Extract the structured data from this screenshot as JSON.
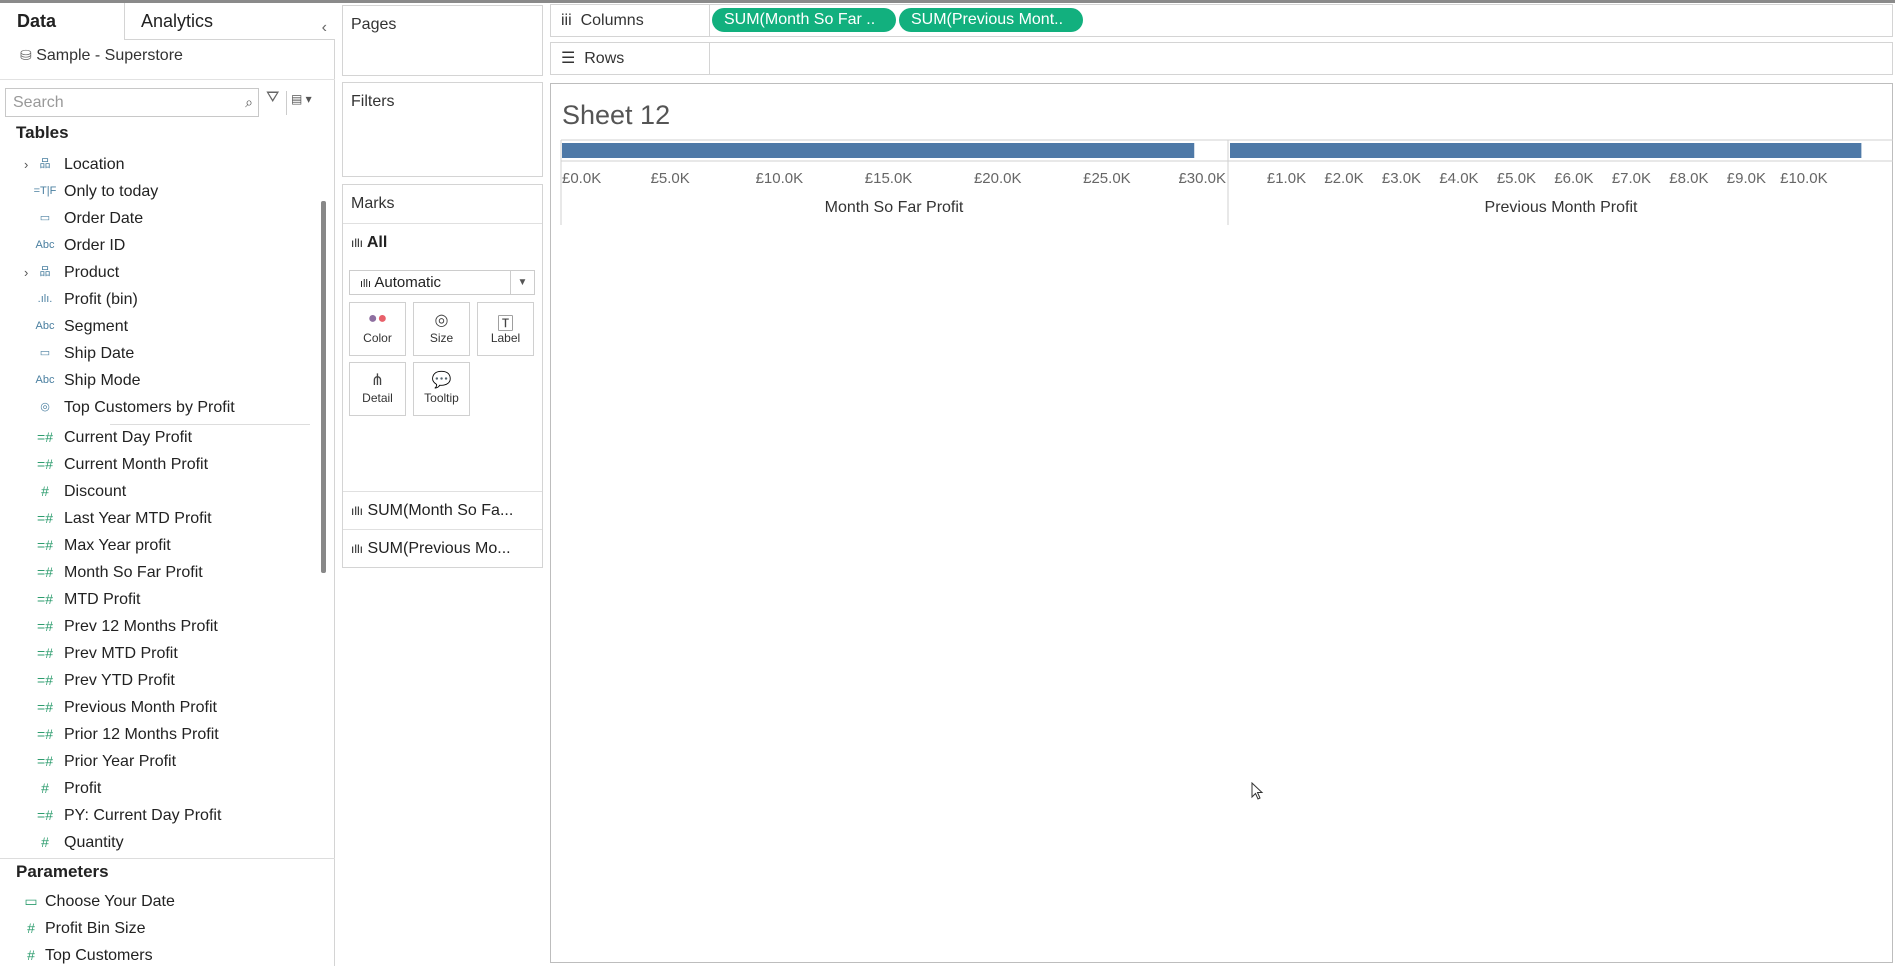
{
  "left_panel": {
    "tabs": [
      "Data",
      "Analytics"
    ],
    "data_source": "Sample - Superstore",
    "search_placeholder": "Search",
    "tables_heading": "Tables",
    "dimensions": [
      {
        "label": "Location",
        "icon": "hierarchy-icon",
        "expandable": true
      },
      {
        "label": "Only to today",
        "icon": "boolean-icon"
      },
      {
        "label": "Order Date",
        "icon": "calendar-icon"
      },
      {
        "label": "Order ID",
        "icon": "abc-icon"
      },
      {
        "label": "Product",
        "icon": "hierarchy-icon",
        "expandable": true
      },
      {
        "label": "Profit (bin)",
        "icon": "bin-icon"
      },
      {
        "label": "Segment",
        "icon": "abc-icon"
      },
      {
        "label": "Ship Date",
        "icon": "calendar-icon"
      },
      {
        "label": "Ship Mode",
        "icon": "abc-icon"
      },
      {
        "label": "Top Customers by Profit",
        "icon": "set-icon"
      }
    ],
    "measures": [
      {
        "label": "Current Day Profit",
        "icon": "calc-measure-icon"
      },
      {
        "label": "Current Month Profit",
        "icon": "calc-measure-icon"
      },
      {
        "label": "Discount",
        "icon": "measure-icon"
      },
      {
        "label": "Last Year MTD Profit",
        "icon": "calc-measure-icon"
      },
      {
        "label": "Max Year profit",
        "icon": "calc-measure-icon"
      },
      {
        "label": "Month So Far Profit",
        "icon": "calc-measure-icon"
      },
      {
        "label": "MTD Profit",
        "icon": "calc-measure-icon"
      },
      {
        "label": "Prev 12 Months Profit",
        "icon": "calc-measure-icon"
      },
      {
        "label": "Prev MTD Profit",
        "icon": "calc-measure-icon"
      },
      {
        "label": "Prev YTD Profit",
        "icon": "calc-measure-icon"
      },
      {
        "label": "Previous Month Profit",
        "icon": "calc-measure-icon"
      },
      {
        "label": "Prior 12 Months Profit",
        "icon": "calc-measure-icon"
      },
      {
        "label": "Prior Year Profit",
        "icon": "calc-measure-icon"
      },
      {
        "label": "Profit",
        "icon": "measure-icon"
      },
      {
        "label": "PY: Current Day Profit",
        "icon": "calc-measure-icon"
      },
      {
        "label": "Quantity",
        "icon": "measure-icon"
      }
    ],
    "parameters_heading": "Parameters",
    "parameters": [
      {
        "label": "Choose Your Date",
        "icon": "calendar-icon"
      },
      {
        "label": "Profit Bin Size",
        "icon": "measure-icon"
      },
      {
        "label": "Top Customers",
        "icon": "measure-icon"
      }
    ]
  },
  "cards": {
    "pages": "Pages",
    "filters": "Filters",
    "marks": "Marks",
    "marks_all": "All",
    "mark_type": "Automatic",
    "buttons": [
      "Color",
      "Size",
      "Label",
      "Detail",
      "Tooltip"
    ],
    "mark_rows": [
      "SUM(Month So Fa...",
      "SUM(Previous Mo..."
    ]
  },
  "shelves": {
    "columns_label": "Columns",
    "rows_label": "Rows",
    "column_pills": [
      "SUM(Month So Far ..",
      "SUM(Previous Mont.."
    ],
    "pill_color": "#12b07e"
  },
  "sheet": {
    "title": "Sheet 12"
  },
  "chart_data": [
    {
      "type": "bar",
      "orientation": "horizontal",
      "xlabel": "Month So Far Profit",
      "values": [
        29000
      ],
      "xlim": [
        0,
        30500
      ],
      "tick_labels": [
        "£0.0K",
        "£5.0K",
        "£10.0K",
        "£15.0K",
        "£20.0K",
        "£25.0K",
        "£30.0K"
      ],
      "ticks": [
        0,
        5000,
        10000,
        15000,
        20000,
        25000,
        30000
      ],
      "color": "#4e79a7"
    },
    {
      "type": "bar",
      "orientation": "horizontal",
      "xlabel": "Previous Month Profit",
      "values": [
        11000
      ],
      "xlim": [
        0,
        11550
      ],
      "tick_labels": [
        "£1.0K",
        "£2.0K",
        "£3.0K",
        "£4.0K",
        "£5.0K",
        "£6.0K",
        "£7.0K",
        "£8.0K",
        "£9.0K",
        "£10.0K"
      ],
      "ticks": [
        1000,
        2000,
        3000,
        4000,
        5000,
        6000,
        7000,
        8000,
        9000,
        10000
      ],
      "color": "#4e79a7"
    }
  ]
}
